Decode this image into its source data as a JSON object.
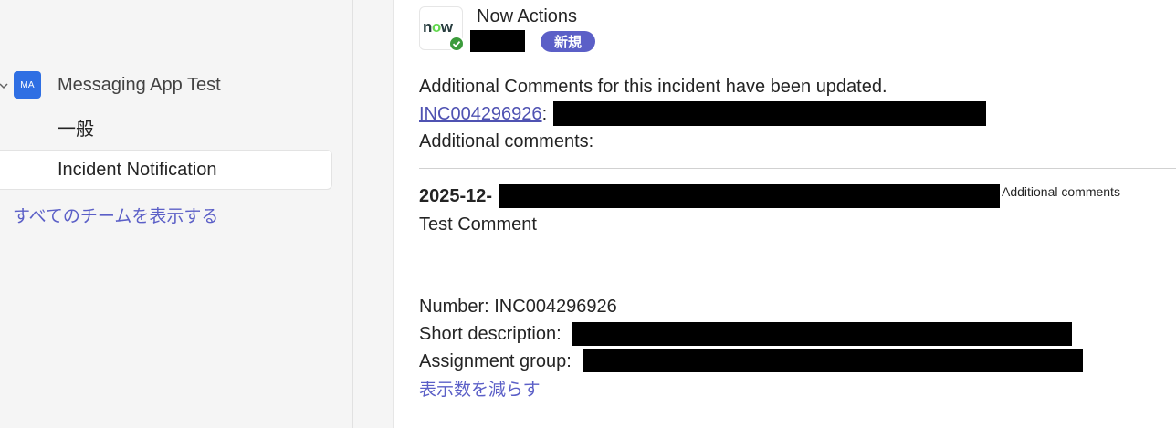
{
  "sidebar": {
    "team": {
      "avatar_text": "MA",
      "name": "Messaging App Test",
      "avatar_color": "#2f6fe3"
    },
    "channels": [
      {
        "label": "一般",
        "selected": false
      },
      {
        "label": "Incident Notification",
        "selected": true
      }
    ],
    "see_all_label": "すべてのチームを表示する"
  },
  "message": {
    "app_logo_text_prefix": "n",
    "app_logo_text_o": "o",
    "app_logo_text_suffix": "w",
    "sender_name": "Now Actions",
    "new_badge": "新規",
    "intro": "Additional Comments for this incident have been updated.",
    "incident_link": "INC004296926",
    "incident_sep": ":",
    "additional_comments_heading": "Additional comments:",
    "entry_date_prefix": "2025-12-",
    "entry_side_label": "Additional comments",
    "entry_comment": "Test Comment",
    "number_line": "Number: INC004296926",
    "short_description_label": "Short description:",
    "assignment_group_label": "Assignment group:",
    "show_less_label": "表示数を減らす"
  },
  "colors": {
    "accent": "#5b5fc7",
    "link": "#4f52b2",
    "verified": "#3b9b3b",
    "redaction": "#000000"
  }
}
